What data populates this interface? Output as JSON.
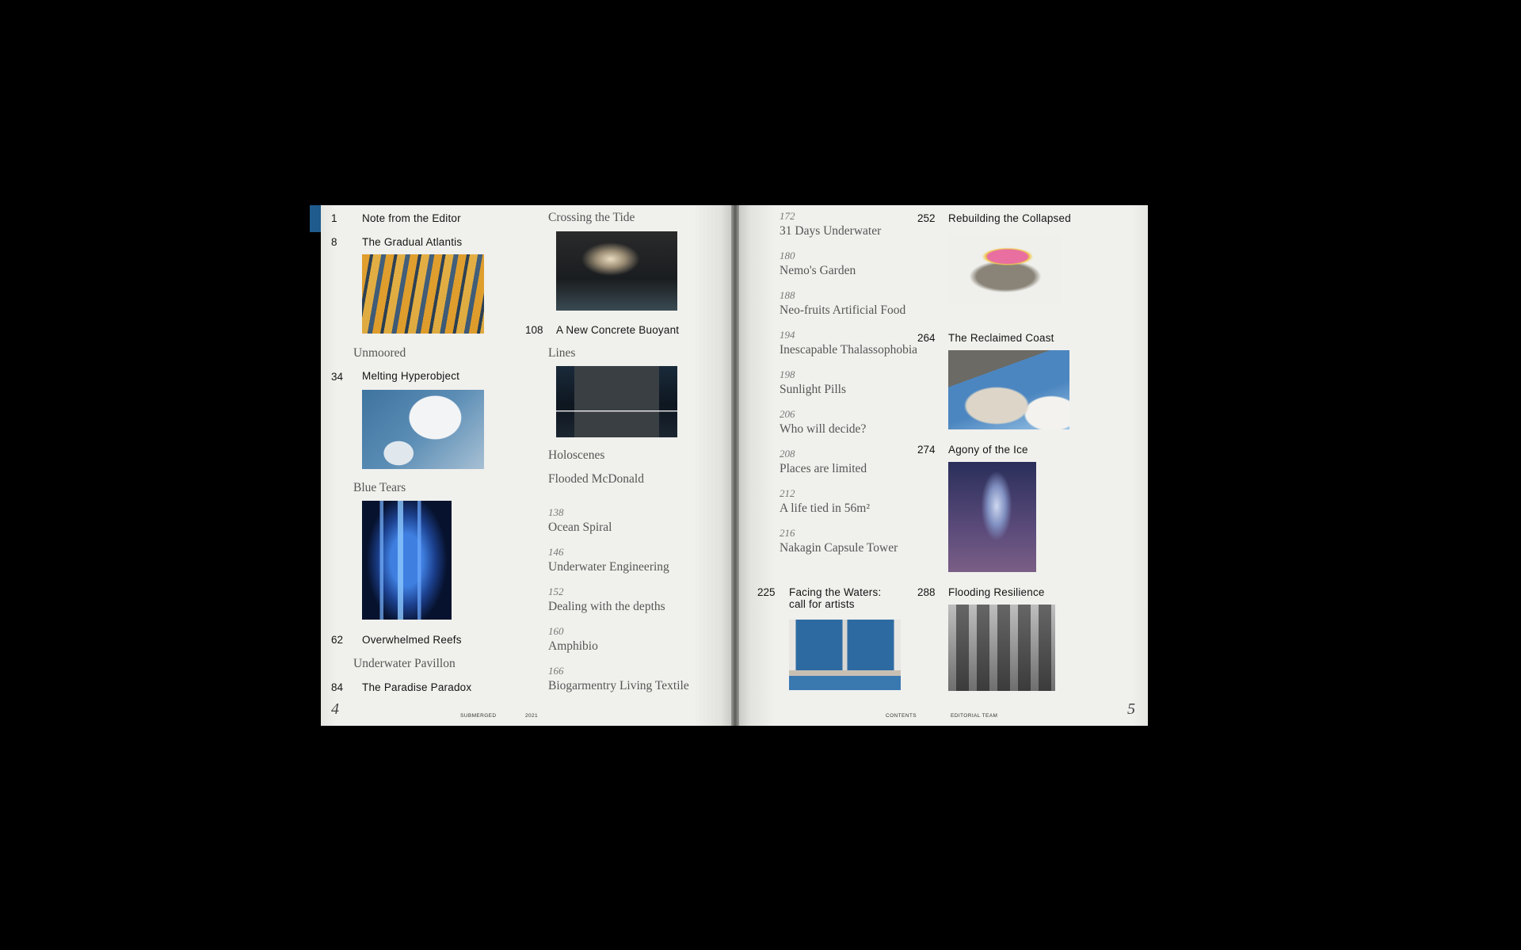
{
  "left_page": {
    "col1": {
      "entries": [
        {
          "num": "1",
          "title": "Note from the Editor"
        },
        {
          "num": "8",
          "title": "The Gradual Atlantis"
        },
        {
          "num": "",
          "title": "Unmoored"
        },
        {
          "num": "34",
          "title": "Melting Hyperobject"
        },
        {
          "num": "",
          "title": "Blue Tears"
        },
        {
          "num": "62",
          "title": "Overwhelmed Reefs"
        },
        {
          "num": "",
          "title": "Underwater Pavillon"
        },
        {
          "num": "84",
          "title": "The Paradise Paradox"
        }
      ]
    },
    "col2": {
      "entries": [
        {
          "num": "",
          "title": "Crossing the Tide"
        },
        {
          "num": "108",
          "title": "A New Concrete Buoyant"
        },
        {
          "num": "",
          "title": "Lines"
        },
        {
          "num": "",
          "title": "Holoscenes"
        },
        {
          "num": "",
          "title": "Flooded McDonald"
        },
        {
          "num": "138",
          "title": "Ocean Spiral"
        },
        {
          "num": "146",
          "title": "Underwater Engineering"
        },
        {
          "num": "152",
          "title": "Dealing with the depths"
        },
        {
          "num": "160",
          "title": "Amphibio"
        },
        {
          "num": "166",
          "title": "Biogarmentry Living Textile"
        }
      ]
    },
    "footer": {
      "folio": "4",
      "label1": "SUBMERGED",
      "label2": "2021"
    }
  },
  "right_page": {
    "col1": {
      "entries": [
        {
          "num": "172",
          "title": "31 Days Underwater"
        },
        {
          "num": "180",
          "title": "Nemo's Garden"
        },
        {
          "num": "188",
          "title": "Neo-fruits Artificial Food"
        },
        {
          "num": "194",
          "title": "Inescapable Thalassophobia"
        },
        {
          "num": "198",
          "title": "Sunlight Pills"
        },
        {
          "num": "206",
          "title": "Who will decide?"
        },
        {
          "num": "208",
          "title": "Places are limited"
        },
        {
          "num": "212",
          "title": "A life tied in 56m²"
        },
        {
          "num": "216",
          "title": "Nakagin Capsule Tower"
        },
        {
          "num": "225",
          "title": "Facing the Waters:",
          "title2": "call for artists"
        }
      ]
    },
    "col2": {
      "entries": [
        {
          "num": "252",
          "title": "Rebuilding the Collapsed"
        },
        {
          "num": "264",
          "title": "The Reclaimed Coast"
        },
        {
          "num": "274",
          "title": "Agony of the Ice"
        },
        {
          "num": "288",
          "title": "Flooding Resilience"
        }
      ]
    },
    "footer": {
      "folio": "5",
      "label1": "CONTENTS",
      "label2": "EDITORIAL TEAM"
    }
  }
}
